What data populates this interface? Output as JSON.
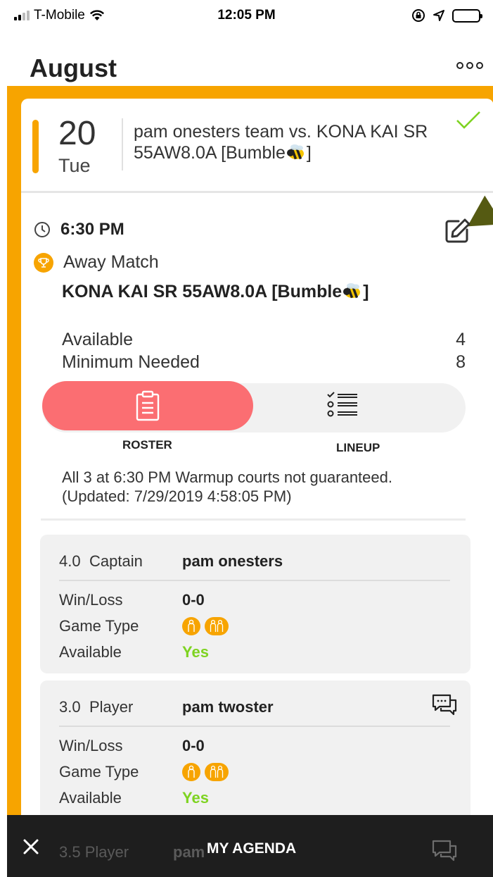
{
  "status_bar": {
    "carrier": "T-Mobile",
    "time": "12:05 PM"
  },
  "header": {
    "title": "August"
  },
  "match": {
    "day": "20",
    "weekday": "Tue",
    "title": "pam onesters team vs. KONA KAI SR 55AW8.0A [Bumble",
    "title_end": "]",
    "time": "6:30 PM",
    "location_type": "Away Match",
    "opponent": "KONA KAI SR 55AW8.0A [Bumble",
    "opponent_end": "]",
    "available_label": "Available",
    "available_count": "4",
    "minimum_label": "Minimum Needed",
    "minimum_count": "8",
    "notes": "All 3 at 6:30 PM Warmup courts not guaranteed.",
    "updated": "(Updated: 7/29/2019 4:58:05 PM)"
  },
  "tabs": {
    "roster": "ROSTER",
    "lineup": "LINEUP"
  },
  "players": [
    {
      "rating": "4.0",
      "role": "Captain",
      "name": "pam onesters",
      "winloss_label": "Win/Loss",
      "winloss": "0-0",
      "gametype_label": "Game Type",
      "available_label": "Available",
      "available": "Yes"
    },
    {
      "rating": "3.0",
      "role": "Player",
      "name": "pam twoster",
      "winloss_label": "Win/Loss",
      "winloss": "0-0",
      "gametype_label": "Game Type",
      "available_label": "Available",
      "available": "Yes"
    }
  ],
  "peek_player": {
    "rating": "3.5 Player",
    "name": "pam"
  },
  "bottom_bar": {
    "label": "MY AGENDA"
  },
  "colors": {
    "accent": "#f7a400",
    "roster_active": "#fb6e72",
    "available_yes": "#7ed321",
    "check": "#7ed321"
  },
  "icons": [
    "signal-icon",
    "wifi-icon",
    "rotation-lock-icon",
    "location-icon",
    "battery-icon",
    "more-icon",
    "check-icon",
    "clock-icon",
    "edit-icon",
    "trophy-icon",
    "bee-emoji-icon",
    "clipboard-icon",
    "lineup-list-icon",
    "chat-icon",
    "singles-icon",
    "doubles-icon",
    "close-icon"
  ]
}
